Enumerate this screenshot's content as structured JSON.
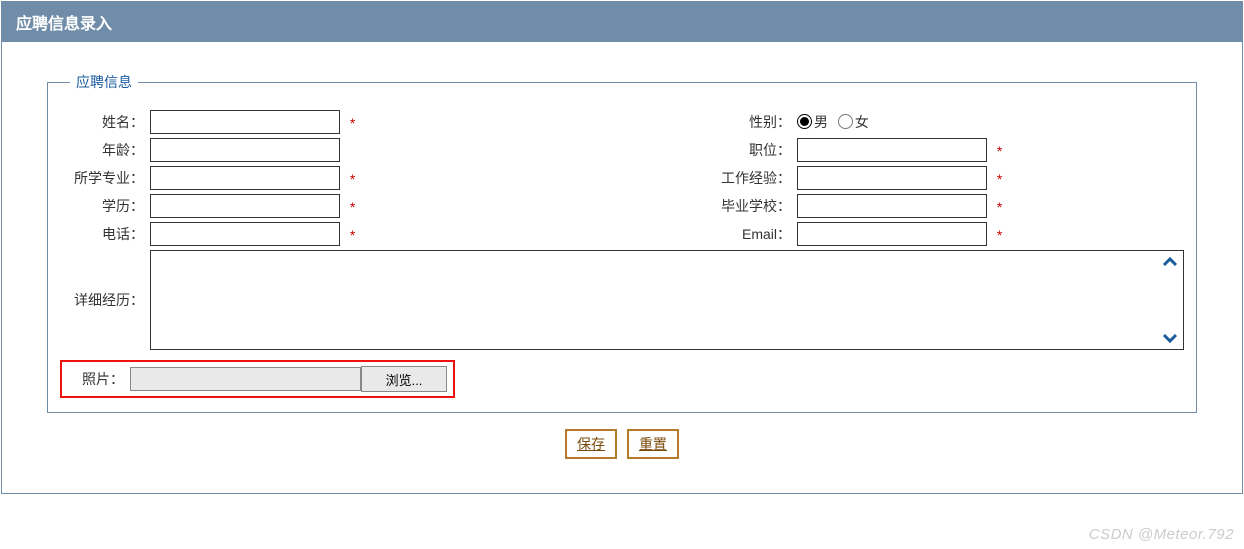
{
  "page": {
    "title": "应聘信息录入",
    "legend": "应聘信息"
  },
  "fields": {
    "name": {
      "label": "姓名：",
      "value": "",
      "required": true
    },
    "gender": {
      "label": "性别：",
      "options": {
        "male": "男",
        "female": "女"
      },
      "selected": "male"
    },
    "age": {
      "label": "年龄：",
      "value": "",
      "required": false
    },
    "position": {
      "label": "职位：",
      "value": "",
      "required": true
    },
    "major": {
      "label": "所学专业：",
      "value": "",
      "required": true
    },
    "experience": {
      "label": "工作经验：",
      "value": "",
      "required": true
    },
    "education": {
      "label": "学历：",
      "value": "",
      "required": true
    },
    "school": {
      "label": "毕业学校：",
      "value": "",
      "required": true
    },
    "phone": {
      "label": "电话：",
      "value": "",
      "required": true
    },
    "email": {
      "label": "Email：",
      "value": "",
      "required": true
    },
    "detail": {
      "label": "详细经历：",
      "value": ""
    },
    "photo": {
      "label": "照片：",
      "path": "",
      "browse_label": "浏览..."
    }
  },
  "marks": {
    "required": "*"
  },
  "buttons": {
    "save": "保存",
    "reset": "重置"
  },
  "watermark": "CSDN @Meteor.792"
}
